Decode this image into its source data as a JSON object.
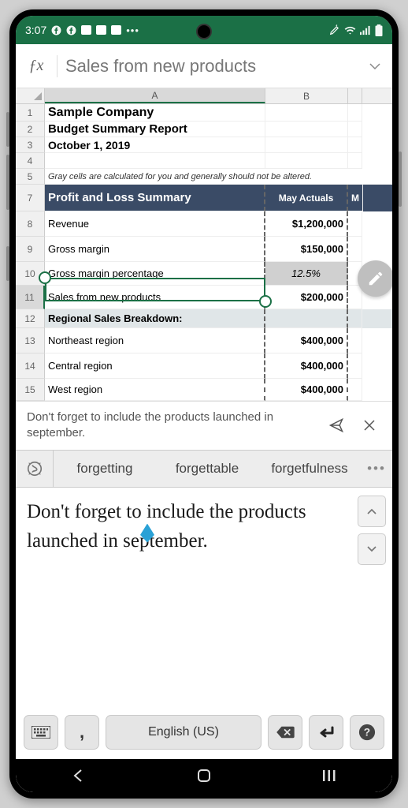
{
  "status": {
    "time": "3:07",
    "battery_pct": ""
  },
  "formula": {
    "text": "Sales from new products"
  },
  "columns": {
    "A": "A",
    "B": "B"
  },
  "rows": {
    "r1": {
      "n": "1",
      "a": "Sample Company"
    },
    "r2": {
      "n": "2",
      "a": "Budget Summary Report"
    },
    "r3": {
      "n": "3",
      "a": "October 1, 2019"
    },
    "r4": {
      "n": "4",
      "a": ""
    },
    "r5": {
      "n": "5",
      "a": "Gray cells are calculated for you and generally should not be altered."
    },
    "r7": {
      "n": "7",
      "a": "Profit and Loss Summary",
      "b": "May Actuals",
      "c": "M"
    },
    "r8": {
      "n": "8",
      "a": "Revenue",
      "b": "$1,200,000"
    },
    "r9": {
      "n": "9",
      "a": "Gross margin",
      "b": "$150,000"
    },
    "r10": {
      "n": "10",
      "a": "Gross margin percentage",
      "b": "12.5%"
    },
    "r11": {
      "n": "11",
      "a": "Sales from new products",
      "b": "$200,000"
    },
    "r12": {
      "n": "12",
      "a": "Regional Sales Breakdown:",
      "b": ""
    },
    "r13": {
      "n": "13",
      "a": "Northeast region",
      "b": "$400,000"
    },
    "r14": {
      "n": "14",
      "a": "Central region",
      "b": "$400,000"
    },
    "r15": {
      "n": "15",
      "a": "West region",
      "b": "$400,000"
    }
  },
  "comment": {
    "text": "Don't forget to include the products launched in september."
  },
  "suggestions": {
    "s1": "forgetting",
    "s2": "forgettable",
    "s3": "forgetfulness"
  },
  "handwriting": {
    "text": "Don't forget to include the products launched in september."
  },
  "keyboard": {
    "comma": ",",
    "lang": "English (US)"
  }
}
